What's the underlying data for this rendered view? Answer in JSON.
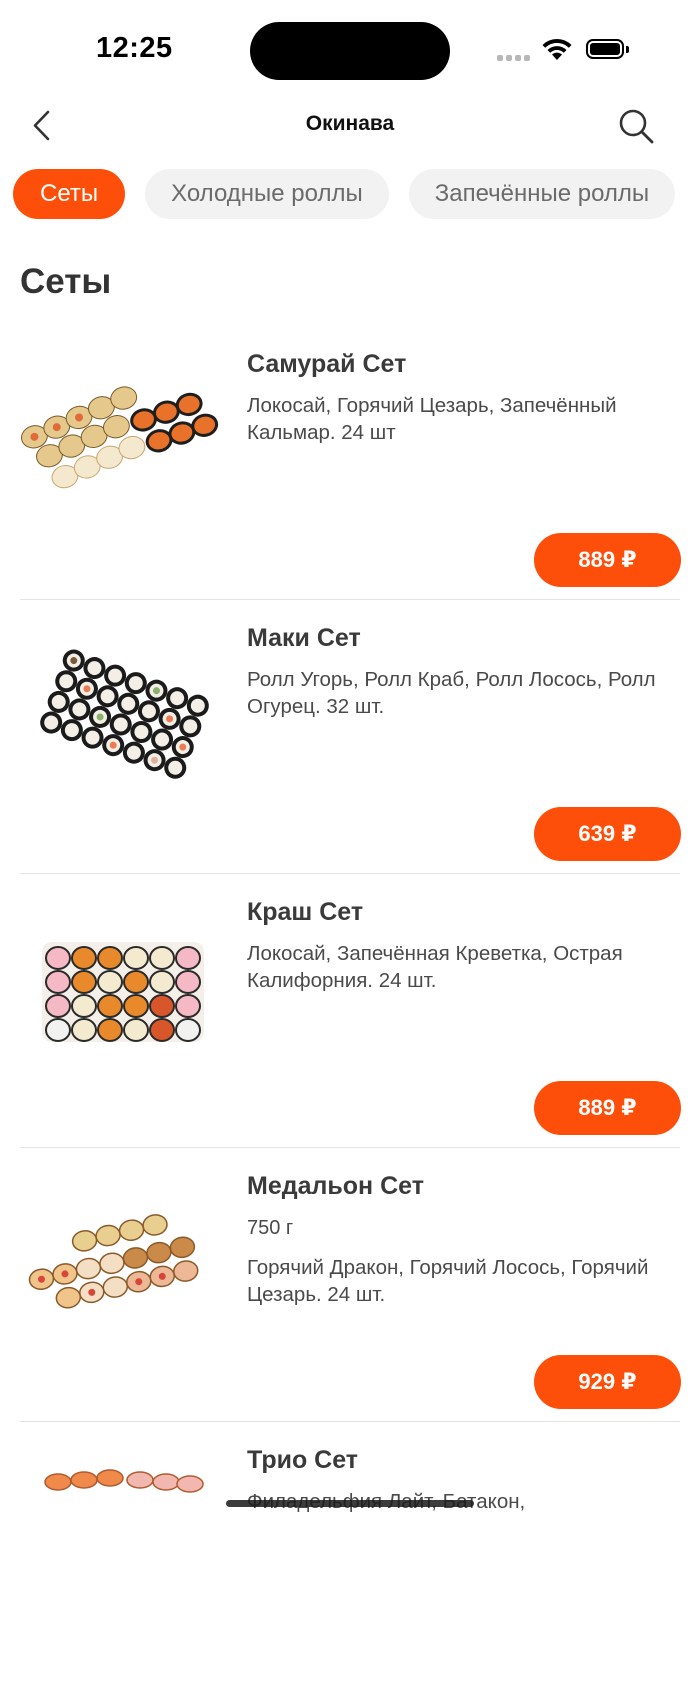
{
  "status_bar": {
    "time": "12:25"
  },
  "nav": {
    "title": "Окинава"
  },
  "tabs": [
    {
      "label": "Сеты",
      "active": true
    },
    {
      "label": "Холодные роллы",
      "active": false
    },
    {
      "label": "Запечённые роллы",
      "active": false
    }
  ],
  "section": {
    "title": "Сеты"
  },
  "products": [
    {
      "name": "Самурай Сет",
      "description": "Локосай, Горячий Цезарь, Запечённый Кальмар. 24 шт",
      "price": "889 ₽"
    },
    {
      "name": "Маки Сет",
      "description": "Ролл Угорь, Ролл Краб, Ролл Лосось, Ролл Огурец. 32 шт.",
      "price": "639 ₽"
    },
    {
      "name": "Краш Сет",
      "description": "Локосай, Запечённая Креветка, Острая Калифорния. 24 шт.",
      "price": "889 ₽"
    },
    {
      "name": "Медальон Сет",
      "weight": "750 г",
      "description": "Горячий Дракон, Горячий Лосось, Горячий Цезарь. 24 шт.",
      "price": "929 ₽"
    },
    {
      "name": "Трио Сет",
      "description": "Филадельфия Лайт, Батакон,"
    }
  ],
  "colors": {
    "accent": "#fe4f0a",
    "tab_inactive_bg": "#f2f2f2"
  }
}
